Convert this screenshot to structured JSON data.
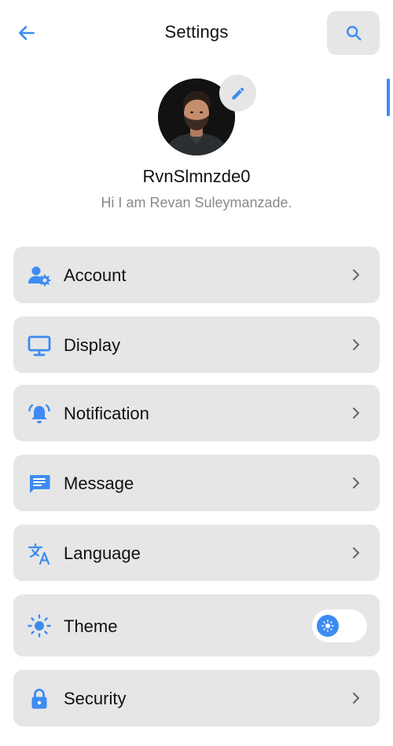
{
  "header": {
    "title": "Settings",
    "back_icon": "arrow-left-icon",
    "search_icon": "search-icon"
  },
  "profile": {
    "username": "RvnSlmnzde0",
    "bio": "Hi I am Revan Suleymanzade.",
    "edit_icon": "pencil-icon"
  },
  "menu": {
    "items": [
      {
        "label": "Account",
        "icon": "account-settings-icon"
      },
      {
        "label": "Display",
        "icon": "monitor-icon"
      },
      {
        "label": "Notification",
        "icon": "bell-icon"
      },
      {
        "label": "Message",
        "icon": "message-icon"
      },
      {
        "label": "Language",
        "icon": "translate-icon"
      },
      {
        "label": "Theme",
        "icon": "sun-icon",
        "toggle_on": true
      },
      {
        "label": "Security",
        "icon": "lock-icon"
      }
    ]
  },
  "colors": {
    "accent": "#3d8bf2",
    "card": "#e6e6e6",
    "text": "#111111",
    "muted": "#8a8a8a"
  }
}
